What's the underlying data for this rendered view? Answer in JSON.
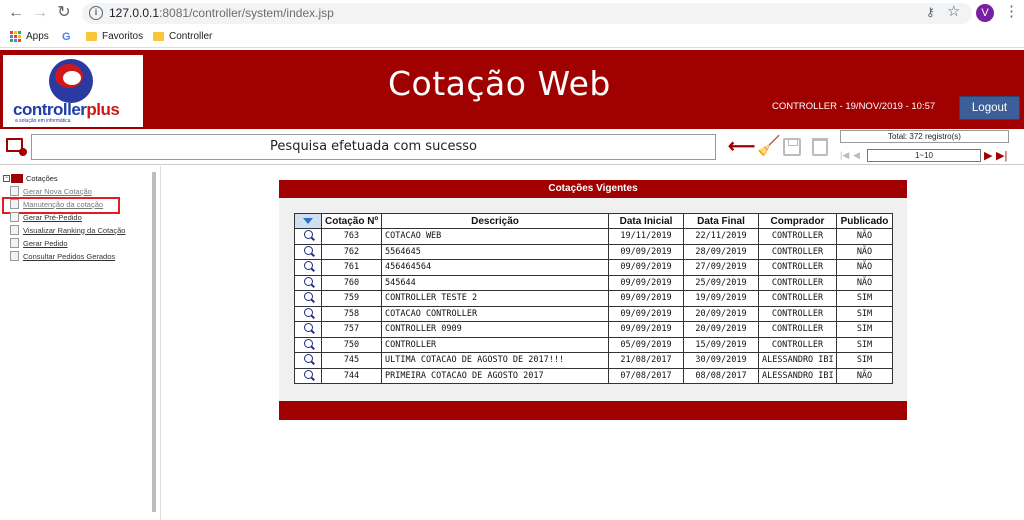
{
  "browser": {
    "url_host": "127.0.0.1",
    "url_rest": ":8081/controller/system/index.jsp",
    "avatar_letter": "V",
    "bookmarks": [
      {
        "label": "Apps"
      },
      {
        "label": "Favoritos"
      },
      {
        "label": "Controller"
      }
    ]
  },
  "header": {
    "logo_text": "controller",
    "logo_plus": "plus",
    "logo_sub": "a solução em informática",
    "title": "Cotação Web",
    "user_info": "CONTROLLER - 19/NOV/2019 - 10:57",
    "logout_label": "Logout",
    "colors": {
      "brand_red": "#a00000",
      "logout_blue": "#3d5f99"
    }
  },
  "toolbar": {
    "status_message": "Pesquisa efetuada com sucesso",
    "total_label": "Total: 372 registro(s)",
    "page_range": "1~10"
  },
  "sidebar": {
    "root_label": "Cotações",
    "items": [
      {
        "label": "Gerar Nova Cotação"
      },
      {
        "label": "Manutenção da cotação"
      },
      {
        "label": "Gerar Pré-Pedido"
      },
      {
        "label": "Visualizar Ranking da Cotação"
      },
      {
        "label": "Gerar Pedido"
      },
      {
        "label": "Consultar Pedidos Gerados"
      }
    ]
  },
  "main": {
    "panel_title": "Cotações Vigentes",
    "columns": [
      "",
      "Cotação Nº",
      "Descrição",
      "Data Inicial",
      "Data Final",
      "Comprador",
      "Publicado"
    ],
    "rows": [
      {
        "num": "763",
        "desc": "COTACAO WEB",
        "inicio": "19/11/2019",
        "fim": "22/11/2019",
        "comprador": "CONTROLLER",
        "publicado": "NÃO"
      },
      {
        "num": "762",
        "desc": "5564645",
        "inicio": "09/09/2019",
        "fim": "28/09/2019",
        "comprador": "CONTROLLER",
        "publicado": "NÃO"
      },
      {
        "num": "761",
        "desc": "456464564",
        "inicio": "09/09/2019",
        "fim": "27/09/2019",
        "comprador": "CONTROLLER",
        "publicado": "NÃO"
      },
      {
        "num": "760",
        "desc": "545644",
        "inicio": "09/09/2019",
        "fim": "25/09/2019",
        "comprador": "CONTROLLER",
        "publicado": "NÃO"
      },
      {
        "num": "759",
        "desc": "CONTROLLER TESTE 2",
        "inicio": "09/09/2019",
        "fim": "19/09/2019",
        "comprador": "CONTROLLER",
        "publicado": "SIM"
      },
      {
        "num": "758",
        "desc": "COTACAO CONTROLLER",
        "inicio": "09/09/2019",
        "fim": "20/09/2019",
        "comprador": "CONTROLLER",
        "publicado": "SIM"
      },
      {
        "num": "757",
        "desc": "CONTROLLER 0909",
        "inicio": "09/09/2019",
        "fim": "20/09/2019",
        "comprador": "CONTROLLER",
        "publicado": "SIM"
      },
      {
        "num": "750",
        "desc": "CONTROLLER",
        "inicio": "05/09/2019",
        "fim": "15/09/2019",
        "comprador": "CONTROLLER",
        "publicado": "SIM"
      },
      {
        "num": "745",
        "desc": "ULTIMA COTACAO DE AGOSTO DE 2017!!!",
        "inicio": "21/08/2017",
        "fim": "30/09/2019",
        "comprador": "ALESSANDRO IBI",
        "publicado": "SIM"
      },
      {
        "num": "744",
        "desc": "PRIMEIRA COTACAO DE AGOSTO 2017",
        "inicio": "07/08/2017",
        "fim": "08/08/2017",
        "comprador": "ALESSANDRO IBI",
        "publicado": "NÃO"
      }
    ]
  }
}
